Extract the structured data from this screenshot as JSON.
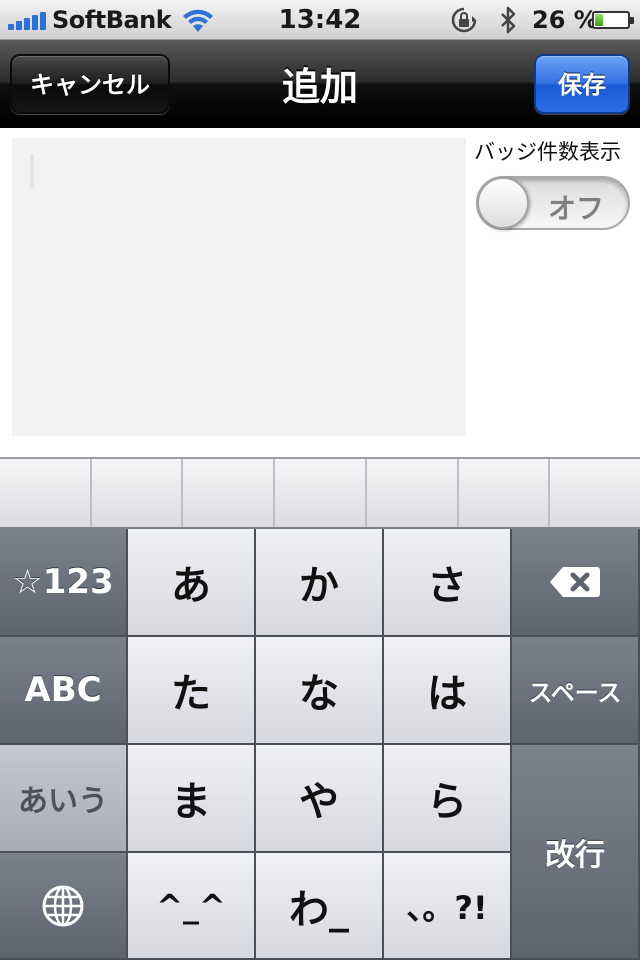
{
  "status_bar": {
    "carrier": "SoftBank",
    "time": "13:42",
    "battery_percent": "26 %",
    "battery_level": 0.26,
    "icons": [
      "signal-icon",
      "wifi-icon",
      "rotation-lock-icon",
      "bluetooth-icon",
      "battery-icon"
    ]
  },
  "nav": {
    "title": "追加",
    "cancel_label": "キャンセル",
    "save_label": "保存"
  },
  "content": {
    "text_value": "",
    "badge_label": "バッジ件数表示",
    "toggle_label": "オフ",
    "toggle_on": false
  },
  "keyboard": {
    "candidate_cells": 7,
    "keys": {
      "numbers": "☆123",
      "abc": "ABC",
      "aiu": "あいう",
      "globe": "globe-icon",
      "a": "あ",
      "ka": "か",
      "sa": "さ",
      "ta": "た",
      "na": "な",
      "ha": "は",
      "ma": "ま",
      "ya": "や",
      "ra": "ら",
      "emoticon": "^_^",
      "wa": "わ_",
      "punct": "、。?!",
      "backspace": "delete-icon",
      "space": "スペース",
      "return": "改行"
    }
  },
  "colors": {
    "save_button": "#2f6fe4",
    "nav_bar": "#1a1a1a",
    "keyboard_bg": "#3a3e46"
  }
}
